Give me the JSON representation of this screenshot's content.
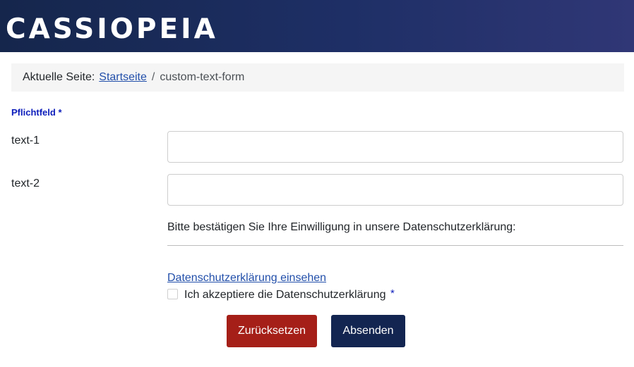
{
  "header": {
    "brand": "CASSIOPEIA"
  },
  "breadcrumb": {
    "prefix": "Aktuelle Seite:",
    "home_link": "Startseite",
    "separator": "/",
    "current": "custom-text-form"
  },
  "form": {
    "required_note": "Pflichtfeld *",
    "fields": [
      {
        "label": "text-1",
        "value": "",
        "placeholder": ""
      },
      {
        "label": "text-2",
        "value": "",
        "placeholder": ""
      }
    ],
    "consent_text": "Bitte bestätigen Sie Ihre Einwilligung in unsere Datenschutzerklärung:",
    "privacy_link": "Datenschutzerklärung einsehen",
    "checkbox_label": "Ich akzeptiere die Datenschutzerklärung",
    "checkbox_required_marker": "*",
    "checkbox_checked": false,
    "reset_button": "Zurücksetzen",
    "submit_button": "Absenden"
  },
  "colors": {
    "header_gradient_start": "#15264c",
    "header_gradient_end": "#303776",
    "link": "#224faa",
    "required_marker": "#0c1dbb",
    "reset_button": "#a51f18",
    "submit_button": "#132551",
    "breadcrumb_bg": "#f5f5f5"
  },
  "icons": {
    "checkbox": "checkbox-unchecked-icon"
  }
}
